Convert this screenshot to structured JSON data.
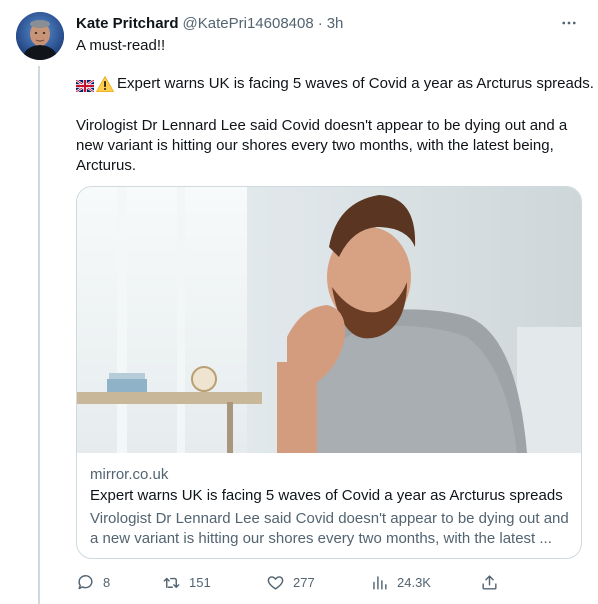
{
  "tweet": {
    "author_name": "Kate Pritchard",
    "author_handle": "@KatePri14608408",
    "separator": "·",
    "time_ago": "3h",
    "more_icon": "more-horizontal-icon",
    "line1": "A must-read!!",
    "line2": "Expert warns UK is facing 5 waves of Covid a year as Arcturus spreads.",
    "line2_emojis": [
      "uk-flag-icon",
      "warning-icon"
    ],
    "body": "Virologist Dr Lennard Lee said Covid doesn't appear to be dying out and a new variant is hitting our shores every two months, with the latest being, Arcturus."
  },
  "link_card": {
    "domain": "mirror.co.uk",
    "title": "Expert warns UK is facing 5 waves of Covid a year as Arcturus spreads",
    "description": "Virologist Dr Lennard Lee said Covid doesn't appear to be dying out and a new variant is hitting our shores every two months, with the latest ..."
  },
  "actions": {
    "replies": "8",
    "retweets": "151",
    "likes": "277",
    "views": "24.3K",
    "icons": [
      "reply-icon",
      "retweet-icon",
      "like-icon",
      "views-icon",
      "share-icon"
    ]
  },
  "colors": {
    "text": "#0f1419",
    "secondary": "#536471",
    "border": "#cfd9de"
  }
}
